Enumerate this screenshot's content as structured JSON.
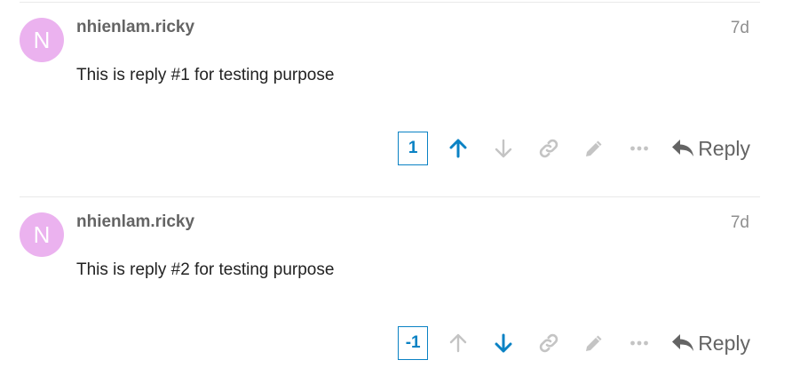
{
  "posts": [
    {
      "avatar_letter": "N",
      "avatar_color": "#ebb2ef",
      "username": "nhienlam.ricky",
      "date": "7d",
      "body": "This is reply #1 for testing purpose",
      "score": "1",
      "upvote_color": "#0a82c4",
      "downvote_color": "#c4c4c4",
      "reply_label": "Reply"
    },
    {
      "avatar_letter": "N",
      "avatar_color": "#ebb2ef",
      "username": "nhienlam.ricky",
      "date": "7d",
      "body": "This is reply #2 for testing purpose",
      "score": "-1",
      "upvote_color": "#c4c4c4",
      "downvote_color": "#0a82c4",
      "reply_label": "Reply"
    }
  ],
  "icons": {
    "upvote": "arrow-up-icon",
    "downvote": "arrow-down-icon",
    "link": "link-icon",
    "edit": "pencil-icon",
    "more": "ellipsis-icon",
    "reply": "reply-arrow-icon"
  },
  "colors": {
    "inactive_icon": "#c4c4c4",
    "accent": "#0a82c4",
    "muted_text": "#646464"
  }
}
